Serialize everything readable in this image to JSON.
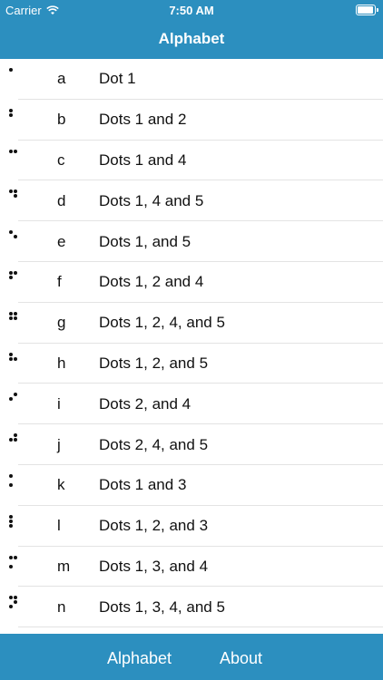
{
  "status": {
    "carrier": "Carrier",
    "time": "7:50 AM"
  },
  "header": {
    "title": "Alphabet"
  },
  "rows": [
    {
      "letter": "a",
      "desc": "Dot 1",
      "dots": [
        1
      ]
    },
    {
      "letter": "b",
      "desc": "Dots 1 and 2",
      "dots": [
        1,
        2
      ]
    },
    {
      "letter": "c",
      "desc": "Dots 1 and 4",
      "dots": [
        1,
        4
      ]
    },
    {
      "letter": "d",
      "desc": "Dots 1, 4 and 5",
      "dots": [
        1,
        4,
        5
      ]
    },
    {
      "letter": "e",
      "desc": "Dots 1, and 5",
      "dots": [
        1,
        5
      ]
    },
    {
      "letter": "f",
      "desc": "Dots 1, 2 and 4",
      "dots": [
        1,
        2,
        4
      ]
    },
    {
      "letter": "g",
      "desc": "Dots 1, 2, 4, and 5",
      "dots": [
        1,
        2,
        4,
        5
      ]
    },
    {
      "letter": "h",
      "desc": "Dots 1, 2, and 5",
      "dots": [
        1,
        2,
        5
      ]
    },
    {
      "letter": "i",
      "desc": "Dots 2, and 4",
      "dots": [
        2,
        4
      ]
    },
    {
      "letter": "j",
      "desc": "Dots 2, 4, and 5",
      "dots": [
        2,
        4,
        5
      ]
    },
    {
      "letter": "k",
      "desc": "Dots 1 and 3",
      "dots": [
        1,
        3
      ]
    },
    {
      "letter": "l",
      "desc": "Dots 1, 2, and 3",
      "dots": [
        1,
        2,
        3
      ]
    },
    {
      "letter": "m",
      "desc": "Dots 1, 3, and 4",
      "dots": [
        1,
        3,
        4
      ]
    },
    {
      "letter": "n",
      "desc": "Dots 1, 3, 4, and 5",
      "dots": [
        1,
        3,
        4,
        5
      ]
    }
  ],
  "tabs": {
    "alphabet": "Alphabet",
    "about": "About"
  }
}
